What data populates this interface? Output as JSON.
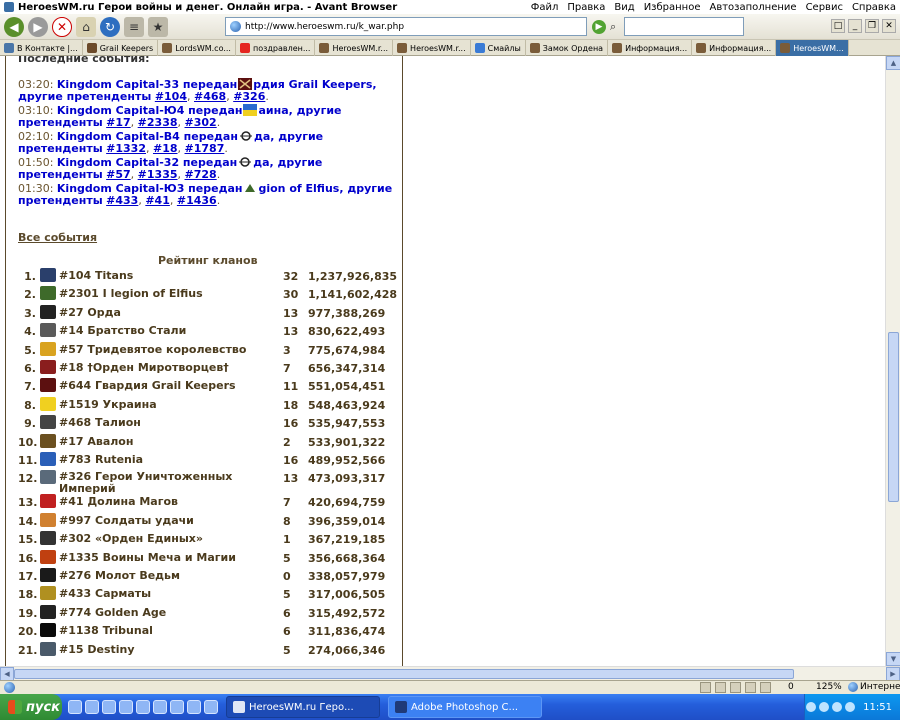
{
  "window": {
    "title": "HeroesWM.ru Герои войны и денег. Онлайн игра. - Avant Browser",
    "menu": [
      "Файл",
      "Правка",
      "Вид",
      "Избранное",
      "Автозаполнение",
      "Сервис",
      "Справка"
    ]
  },
  "toolbar": {
    "address": "http://www.heroeswm.ru/k_war.php"
  },
  "tabs": [
    {
      "label": "В Контакте |..."
    },
    {
      "label": "Grail Keepers"
    },
    {
      "label": "LordsWM.co..."
    },
    {
      "label": "поздравлен..."
    },
    {
      "label": "HeroesWM.r..."
    },
    {
      "label": "HeroesWM.r..."
    },
    {
      "label": "Смайлы"
    },
    {
      "label": "Замок Ордена"
    },
    {
      "label": "Информация..."
    },
    {
      "label": "Информация..."
    },
    {
      "label": "HeroesWM..."
    }
  ],
  "events": {
    "header": "Последние события:",
    "items": [
      {
        "time": "03:20:",
        "text": "Kingdom Capital-33 передан",
        "icon": "skull-icon",
        "rest": "рдия Grail Keepers, другие претенденты",
        "links": [
          "#104",
          "#468",
          "#326"
        ]
      },
      {
        "time": "03:10:",
        "text": "Kingdom Capital-Ю4 передан",
        "icon": "flag-icon",
        "rest": "аина, другие претенденты",
        "links": [
          "#17",
          "#2338",
          "#302"
        ]
      },
      {
        "time": "02:10:",
        "text": "Kingdom Capital-В4 передан",
        "icon": "horde-icon",
        "rest": "да, другие претенденты",
        "links": [
          "#1332",
          "#18",
          "#1787"
        ]
      },
      {
        "time": "01:50:",
        "text": "Kingdom Capital-32 передан",
        "icon": "horde-icon",
        "rest": "да, другие претенденты",
        "links": [
          "#57",
          "#1335",
          "#728"
        ]
      },
      {
        "time": "01:30:",
        "text": "Kingdom Capital-Ю3 передан",
        "icon": "elf-icon",
        "rest": "gion of Elfius, другие претенденты",
        "links": [
          "#433",
          "#41",
          "#1436"
        ]
      }
    ],
    "all_link": "Все события"
  },
  "rating": {
    "title": "Рейтинг кланов",
    "rows": [
      {
        "rank": "1.",
        "name": "#104 Titans",
        "members": "32",
        "score": "1,237,926,835",
        "color": "#2a3f6b"
      },
      {
        "rank": "2.",
        "name": "#2301 I legion of Elfius",
        "members": "30",
        "score": "1,141,602,428",
        "color": "#3e6a2a"
      },
      {
        "rank": "3.",
        "name": "#27 Орда",
        "members": "13",
        "score": "977,388,269",
        "color": "#222222"
      },
      {
        "rank": "4.",
        "name": "#14 Братство Стали",
        "members": "13",
        "score": "830,622,493",
        "color": "#5a5a5a"
      },
      {
        "rank": "5.",
        "name": "#57 Тридевятое королевство",
        "members": "3",
        "score": "775,674,984",
        "color": "#d9a320"
      },
      {
        "rank": "6.",
        "name": "#18 †Орден Миротворцев†",
        "members": "7",
        "score": "656,347,314",
        "color": "#8a1e1e"
      },
      {
        "rank": "7.",
        "name": "#644 Гвардия Grail Keepers",
        "members": "11",
        "score": "551,054,451",
        "color": "#5c1010"
      },
      {
        "rank": "8.",
        "name": "#1519 Украина",
        "members": "18",
        "score": "548,463,924",
        "color": "#f0d020"
      },
      {
        "rank": "9.",
        "name": "#468 Талион",
        "members": "16",
        "score": "535,947,553",
        "color": "#444444"
      },
      {
        "rank": "10.",
        "name": "#17 Авалон",
        "members": "2",
        "score": "533,901,322",
        "color": "#6b5020"
      },
      {
        "rank": "11.",
        "name": "#783 Rutenia",
        "members": "16",
        "score": "489,952,566",
        "color": "#2a5fb8"
      },
      {
        "rank": "12.",
        "name": "#326 Герои Уничтоженных Империй",
        "members": "13",
        "score": "473,093,317",
        "color": "#5a6a7a"
      },
      {
        "rank": "13.",
        "name": "#41 Долина Магов",
        "members": "7",
        "score": "420,694,759",
        "color": "#c02020"
      },
      {
        "rank": "14.",
        "name": "#997 Солдаты удачи",
        "members": "8",
        "score": "396,359,014",
        "color": "#d08030"
      },
      {
        "rank": "15.",
        "name": "#302 «Орден Единых»",
        "members": "1",
        "score": "367,219,185",
        "color": "#333333"
      },
      {
        "rank": "16.",
        "name": "#1335 Воины Меча и Магии",
        "members": "5",
        "score": "356,668,364",
        "color": "#c04010"
      },
      {
        "rank": "17.",
        "name": "#276 Молот Ведьм",
        "members": "0",
        "score": "338,057,979",
        "color": "#1a1a1a"
      },
      {
        "rank": "18.",
        "name": "#433 Сарматы",
        "members": "5",
        "score": "317,006,505",
        "color": "#b09020"
      },
      {
        "rank": "19.",
        "name": "#774 Golden Age",
        "members": "6",
        "score": "315,492,572",
        "color": "#222222"
      },
      {
        "rank": "20.",
        "name": "#1138 Tribunal",
        "members": "6",
        "score": "311,836,474",
        "color": "#0a0a0a"
      },
      {
        "rank": "21.",
        "name": "#15 Destiny",
        "members": "5",
        "score": "274,066,346",
        "color": "#4a5a6a"
      }
    ]
  },
  "statusbar": {
    "count": "0",
    "zoom": "125%",
    "zone": "Интернет"
  },
  "taskbar": {
    "start": "пуск",
    "tasks": [
      "HeroesWM.ru Геро...",
      "Adobe Photoshop C..."
    ],
    "clock": "11:51"
  }
}
